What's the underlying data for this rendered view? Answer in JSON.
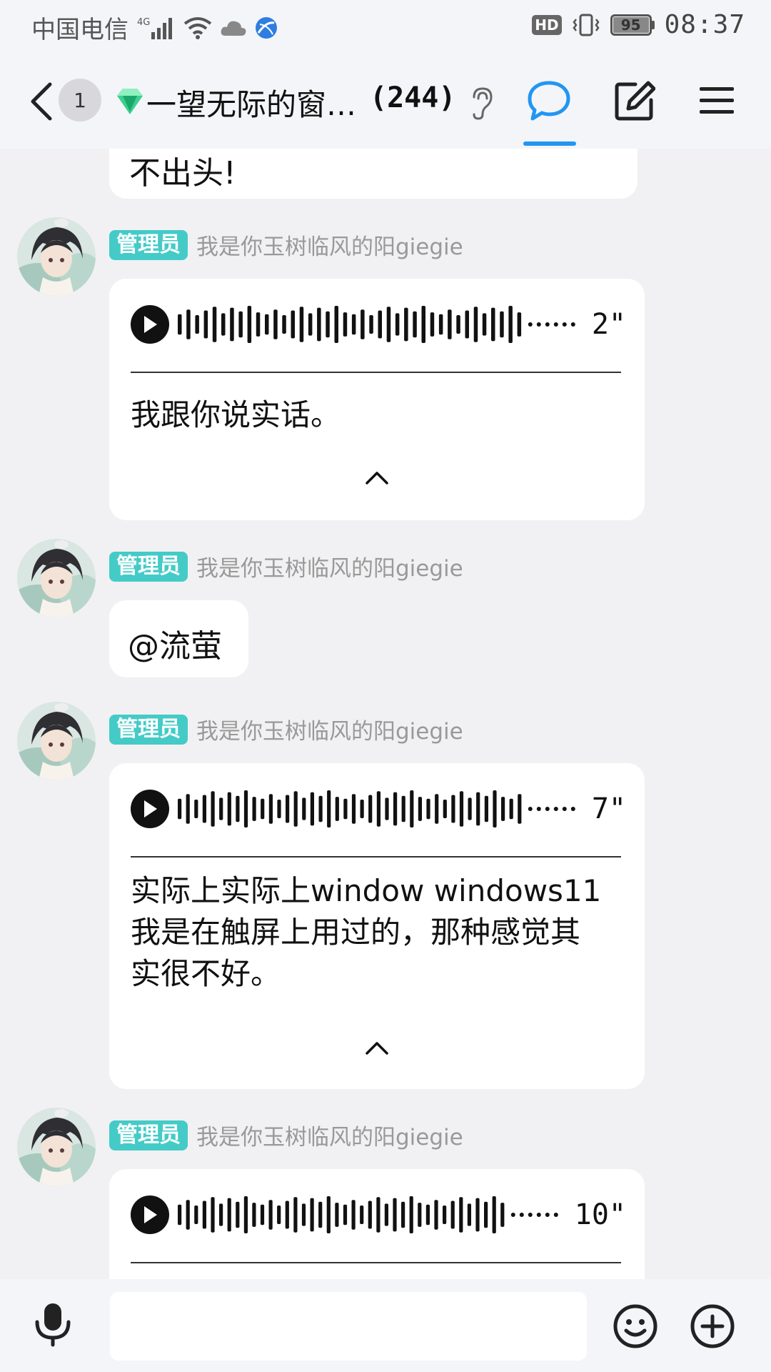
{
  "status_bar": {
    "carrier": "中国电信",
    "network": "4G",
    "hd": "HD",
    "battery": "95",
    "time": "08:37"
  },
  "header": {
    "back_count": "1",
    "title": "一望无际的窗…",
    "member_count": "(244)"
  },
  "colors": {
    "accent": "#2196f3",
    "role_tag": "#44cbc7"
  },
  "messages": [
    {
      "type": "text_fragment",
      "text": "不出头!"
    },
    {
      "type": "voice",
      "role": "管理员",
      "sender": "我是你玉树临风的阳giegie",
      "duration": "2\"",
      "transcript": "我跟你说实话。"
    },
    {
      "type": "text",
      "role": "管理员",
      "sender": "我是你玉树临风的阳giegie",
      "text": "@流萤"
    },
    {
      "type": "voice",
      "role": "管理员",
      "sender": "我是你玉树临风的阳giegie",
      "duration": "7\"",
      "transcript_lines": [
        "实际上实际上window windows11",
        "我是在触屏上用过的，那种感觉其",
        "实很不好。"
      ]
    },
    {
      "type": "voice",
      "role": "管理员",
      "sender": "我是你玉树临风的阳giegie",
      "duration": "10\""
    }
  ],
  "icons": {
    "back": "chevron-left-icon",
    "group": "diamond-icon",
    "ear": "ear-icon",
    "chat": "chat-bubble-icon",
    "edit": "edit-icon",
    "menu": "menu-icon",
    "mic": "microphone-icon",
    "emoji": "emoji-icon",
    "plus": "plus-icon"
  }
}
